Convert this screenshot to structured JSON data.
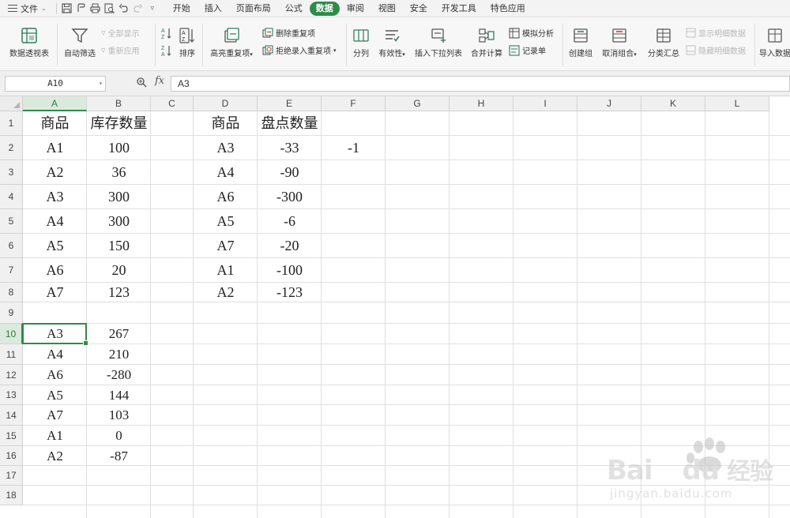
{
  "menubar": {
    "file_label": "文件",
    "tabs": [
      {
        "label": "开始",
        "active": false
      },
      {
        "label": "插入",
        "active": false
      },
      {
        "label": "页面布局",
        "active": false
      },
      {
        "label": "公式",
        "active": false
      },
      {
        "label": "数据",
        "active": true
      },
      {
        "label": "审阅",
        "active": false
      },
      {
        "label": "视图",
        "active": false
      },
      {
        "label": "安全",
        "active": false
      },
      {
        "label": "开发工具",
        "active": false
      },
      {
        "label": "特色应用",
        "active": false
      }
    ]
  },
  "ribbon": {
    "pivot": "数据透视表",
    "autofilter": "自动筛选",
    "show_all": "全部显示",
    "reapply": "重新应用",
    "sort": "排序",
    "highlight_dup": "高亮重复项",
    "remove_dup": "删除重复项",
    "reject_dup": "拒绝录入重复项",
    "split": "分列",
    "validity": "有效性",
    "insert_dropdown": "插入下拉列表",
    "merge_calc": "合并计算",
    "whatif": "模拟分析",
    "record_form": "记录单",
    "group": "创建组",
    "ungroup": "取消组合",
    "subtotal": "分类汇总",
    "show_detail": "显示明细数据",
    "hide_detail": "隐藏明细数据",
    "import": "导入数据"
  },
  "formula_bar": {
    "cell_ref": "A10",
    "fx": "fx",
    "content": "A3"
  },
  "columns": [
    "A",
    "B",
    "C",
    "D",
    "E",
    "F",
    "G",
    "H",
    "I",
    "J",
    "K",
    "L"
  ],
  "rows": [
    "1",
    "2",
    "3",
    "4",
    "5",
    "6",
    "7",
    "8",
    "9",
    "10",
    "11",
    "12",
    "13",
    "14",
    "15",
    "16",
    "17",
    "18"
  ],
  "selected": {
    "column": "A",
    "row": "10"
  },
  "table1": {
    "header_product": "商品",
    "header_stock": "库存数量",
    "rows": [
      {
        "product": "A1",
        "qty": "100"
      },
      {
        "product": "A2",
        "qty": "36"
      },
      {
        "product": "A3",
        "qty": "300"
      },
      {
        "product": "A4",
        "qty": "300"
      },
      {
        "product": "A5",
        "qty": "150"
      },
      {
        "product": "A6",
        "qty": "20"
      },
      {
        "product": "A7",
        "qty": "123"
      }
    ]
  },
  "table2": {
    "header_product": "商品",
    "header_count": "盘点数量",
    "rows": [
      {
        "product": "A3",
        "qty": "-33"
      },
      {
        "product": "A4",
        "qty": "-90"
      },
      {
        "product": "A6",
        "qty": "-300"
      },
      {
        "product": "A5",
        "qty": "-6"
      },
      {
        "product": "A7",
        "qty": "-20"
      },
      {
        "product": "A1",
        "qty": "-100"
      },
      {
        "product": "A2",
        "qty": "-123"
      }
    ]
  },
  "f2_value": "-1",
  "result": {
    "rows": [
      {
        "product": "A3",
        "qty": "267"
      },
      {
        "product": "A4",
        "qty": "210"
      },
      {
        "product": "A6",
        "qty": "-280"
      },
      {
        "product": "A5",
        "qty": "144"
      },
      {
        "product": "A7",
        "qty": "103"
      },
      {
        "product": "A1",
        "qty": "0"
      },
      {
        "product": "A2",
        "qty": "-87"
      }
    ]
  },
  "watermark": {
    "brand": "Bai",
    "brand2": "du",
    "cn": "经验",
    "url": "jingyan.baidu.com"
  },
  "colors": {
    "accent": "#2e8b4a",
    "selected_header_bg": "#dce9dd"
  }
}
